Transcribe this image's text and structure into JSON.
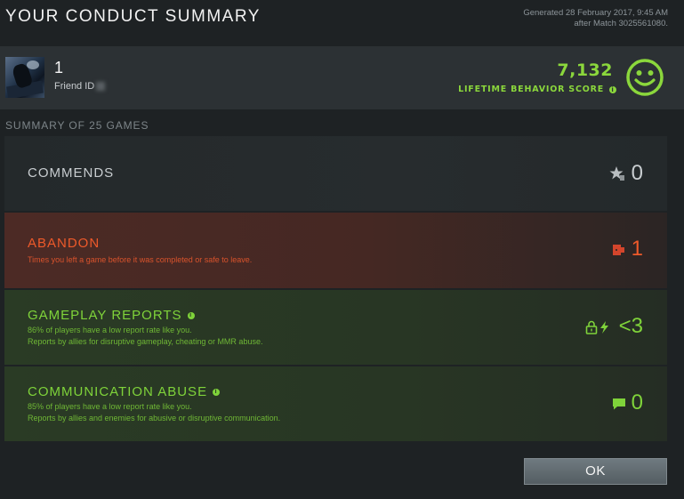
{
  "header": {
    "title": "YOUR CONDUCT SUMMARY",
    "generated_line1": "Generated 28 February 2017, 9:45 AM",
    "generated_line2": "after Match 3025561080."
  },
  "profile": {
    "name": "1",
    "friend_id_label": "Friend ID",
    "score_value": "7,132",
    "score_label": "LIFETIME BEHAVIOR SCORE",
    "score_icon": "smiley-face-icon",
    "accent_color": "#8bd73c"
  },
  "summary": {
    "heading": "SUMMARY OF 25 GAMES",
    "rows": [
      {
        "title": "COMMENDS",
        "subtitle_1": "",
        "subtitle_2": "",
        "count": "0",
        "icon": "star-icon",
        "color": "#c8cdd0"
      },
      {
        "title": "ABANDON",
        "subtitle_1": "Times you left a game before it was completed or safe to leave.",
        "subtitle_2": "",
        "count": "1",
        "icon": "exit-door-icon",
        "color": "#ee5a2a"
      },
      {
        "title": "GAMEPLAY REPORTS",
        "subtitle_1": "86% of players have a low report rate like you.",
        "subtitle_2": "Reports by allies for disruptive gameplay, cheating or MMR abuse.",
        "count": "<3",
        "icon": "lock-lightning-icon",
        "color": "#7fd33a"
      },
      {
        "title": "COMMUNICATION ABUSE",
        "subtitle_1": "85% of players have a low report rate like you.",
        "subtitle_2": "Reports by allies and enemies for abusive or disruptive communication.",
        "count": "0",
        "icon": "chat-bubble-icon",
        "color": "#7fd33a"
      }
    ]
  },
  "footer": {
    "ok_label": "OK"
  }
}
